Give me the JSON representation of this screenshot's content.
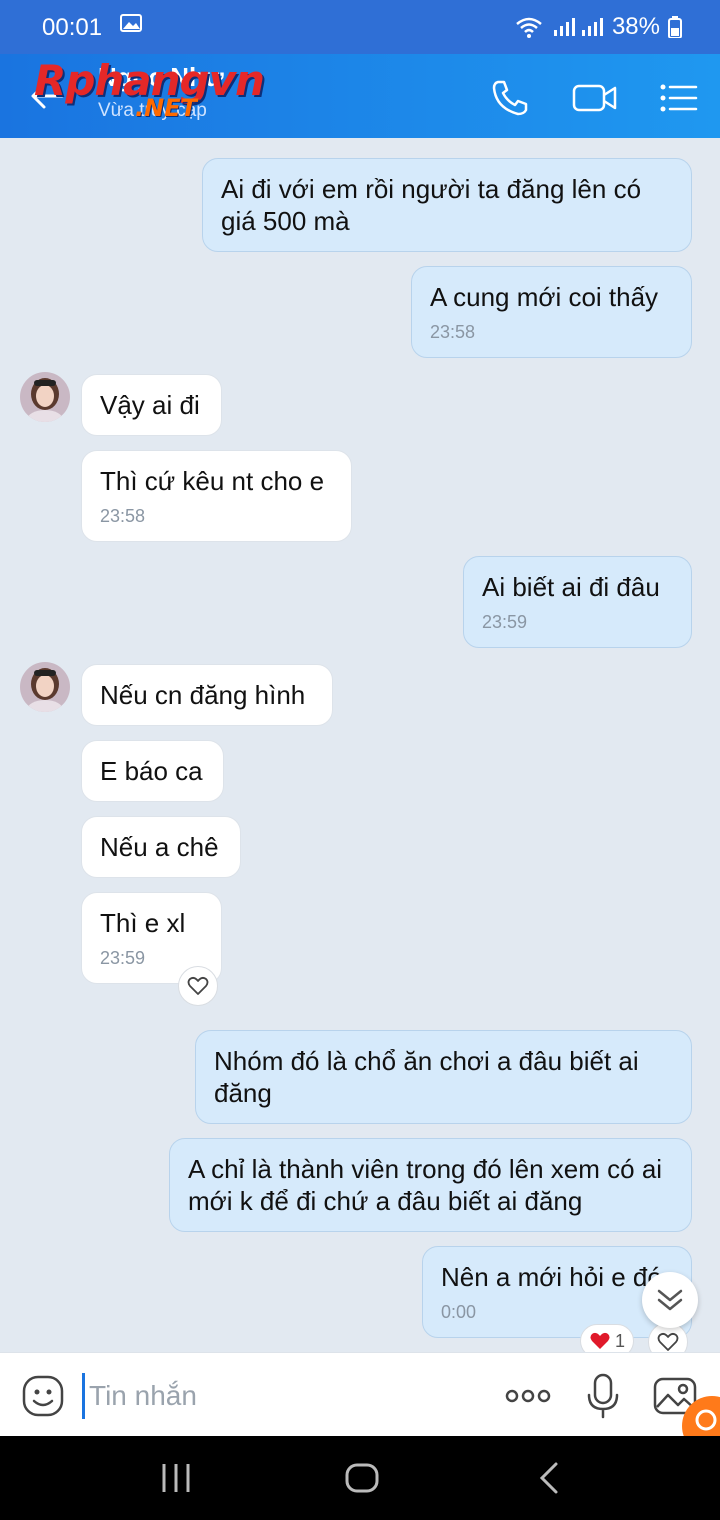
{
  "status": {
    "time": "00:01",
    "battery": "38%"
  },
  "header": {
    "title": "Ngọc Như",
    "subtitle": "Vừa truy cập",
    "watermark_main": "Rphangvn",
    "watermark_sub": ".NET"
  },
  "messages": {
    "m1": {
      "text": "Ai đi với em rồi người ta đăng lên có giá 500 mà"
    },
    "m2": {
      "text": "A cung mới coi thấy",
      "time": "23:58"
    },
    "m3": {
      "text": "Vậy ai đi"
    },
    "m4": {
      "text": "Thì cứ kêu nt cho e",
      "time": "23:58"
    },
    "m5": {
      "text": "Ai biết ai đi đâu",
      "time": "23:59"
    },
    "m6": {
      "text": "Nếu cn đăng hình"
    },
    "m7": {
      "text": "E báo ca"
    },
    "m8": {
      "text": "Nếu a chê"
    },
    "m9": {
      "text": "Thì e xl",
      "time": "23:59"
    },
    "m10": {
      "text": "Nhóm đó là chổ ăn chơi a đâu biết ai đăng"
    },
    "m11": {
      "text": "A chỉ là thành viên trong đó lên xem có ai mới k để đi chứ a đâu biết ai đăng"
    },
    "m12": {
      "text": "Nên a mới hỏi e đó",
      "time": "0:00",
      "reaction_count": "1"
    }
  },
  "input": {
    "placeholder": "Tin nhắn"
  },
  "colors": {
    "header": "#1a74e0",
    "outgoing": "#d6eafb",
    "incoming": "#ffffff",
    "background": "#e2e9f1"
  }
}
